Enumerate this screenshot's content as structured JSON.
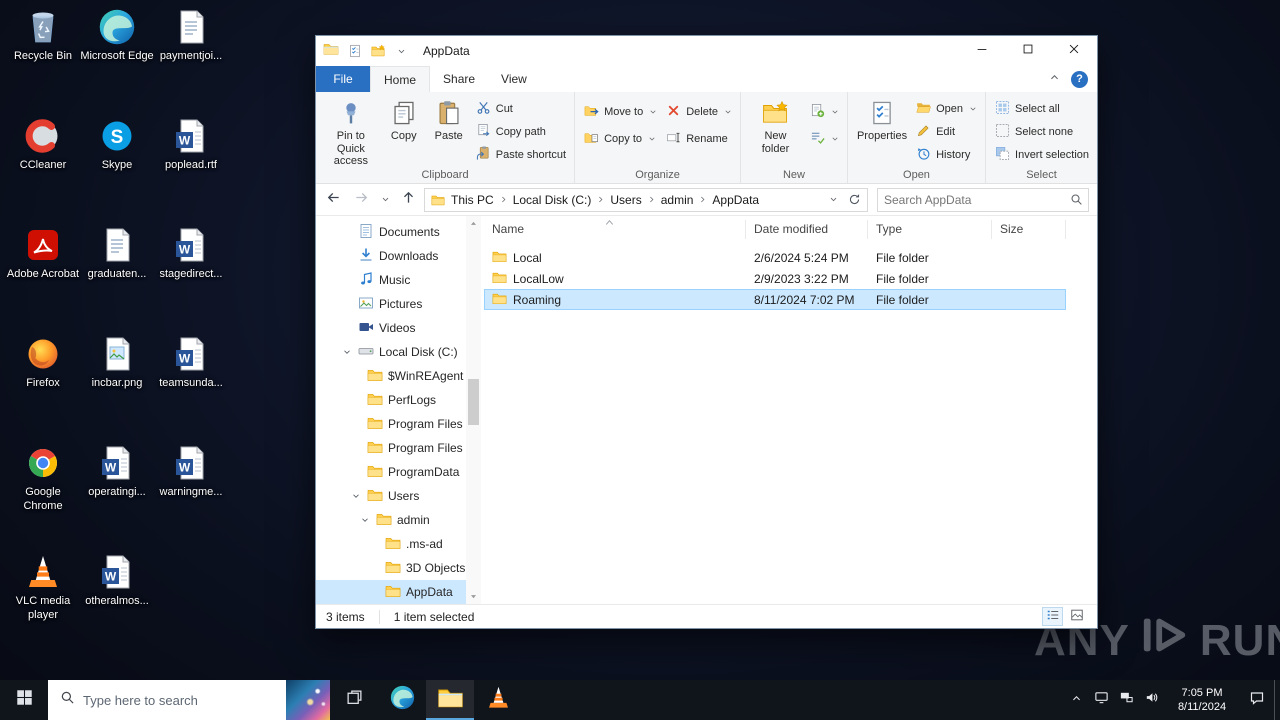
{
  "colors": {
    "accent": "#2a70c2",
    "selection": "#cce8ff",
    "selection_border": "#99d1ff",
    "folder_yellow": "#ffd262",
    "taskbar_bg": "#10141b",
    "desktop_bg": "#0b101f",
    "desktop_glow": "#17203a"
  },
  "desktop": {
    "icons": [
      {
        "label": "Recycle Bin",
        "icon": "recycle-bin"
      },
      {
        "label": "CCleaner",
        "icon": "ccleaner"
      },
      {
        "label": "Adobe Acrobat",
        "icon": "acrobat"
      },
      {
        "label": "Firefox",
        "icon": "firefox"
      },
      {
        "label": "Google Chrome",
        "icon": "chrome"
      },
      {
        "label": "VLC media player",
        "icon": "vlc"
      },
      {
        "label": "Microsoft Edge",
        "icon": "edge"
      },
      {
        "label": "Skype",
        "icon": "skype"
      },
      {
        "label": "graduaten...",
        "icon": "text-doc"
      },
      {
        "label": "incbar.png",
        "icon": "image-file"
      },
      {
        "label": "operatingi...",
        "icon": "word-doc"
      },
      {
        "label": "otheralmos...",
        "icon": "word-doc"
      },
      {
        "label": "paymentjoi...",
        "icon": "text-doc"
      },
      {
        "label": "poplead.rtf",
        "icon": "word-doc"
      },
      {
        "label": "stagedirect...",
        "icon": "word-doc"
      },
      {
        "label": "teamsunda...",
        "icon": "word-doc"
      },
      {
        "label": "warningme...",
        "icon": "word-doc"
      }
    ],
    "watermark": {
      "left": "ANY",
      "right": "RUN"
    }
  },
  "explorer": {
    "titlebar": {
      "title": "AppData"
    },
    "menubar": {
      "file": "File",
      "tabs": [
        "Home",
        "Share",
        "View"
      ],
      "help": "?"
    },
    "ribbon": {
      "group_labels": [
        "Clipboard",
        "Organize",
        "New",
        "Open",
        "Select"
      ],
      "clipboard": {
        "pin": "Pin to Quick access",
        "copy": "Copy",
        "paste": "Paste",
        "cut": "Cut",
        "copy_path": "Copy path",
        "paste_shortcut": "Paste shortcut"
      },
      "organize": {
        "move_to": "Move to",
        "copy_to": "Copy to",
        "delete": "Delete",
        "rename": "Rename"
      },
      "new_group": {
        "new_folder": "New folder"
      },
      "open_group": {
        "properties": "Properties",
        "open": "Open",
        "edit": "Edit",
        "history": "History"
      },
      "select": {
        "select_all": "Select all",
        "select_none": "Select none",
        "invert": "Invert selection"
      }
    },
    "addressbar": {
      "breadcrumb": [
        "This PC",
        "Local Disk (C:)",
        "Users",
        "admin",
        "AppData"
      ],
      "search_placeholder": "Search AppData"
    },
    "nav": [
      {
        "label": "Documents",
        "icon": "documents",
        "indent": 0
      },
      {
        "label": "Downloads",
        "icon": "downloads",
        "indent": 0
      },
      {
        "label": "Music",
        "icon": "music",
        "indent": 0
      },
      {
        "label": "Pictures",
        "icon": "pictures",
        "indent": 0
      },
      {
        "label": "Videos",
        "icon": "videos",
        "indent": 0
      },
      {
        "label": "Local Disk (C:)",
        "icon": "drive",
        "indent": 0,
        "expanded": true
      },
      {
        "label": "$WinREAgent",
        "icon": "folder",
        "indent": 1
      },
      {
        "label": "PerfLogs",
        "icon": "folder",
        "indent": 1
      },
      {
        "label": "Program Files",
        "icon": "folder",
        "indent": 1
      },
      {
        "label": "Program Files",
        "icon": "folder",
        "indent": 1
      },
      {
        "label": "ProgramData",
        "icon": "folder",
        "indent": 1
      },
      {
        "label": "Users",
        "icon": "folder",
        "indent": 1,
        "expanded": true
      },
      {
        "label": "admin",
        "icon": "folder",
        "indent": 2,
        "expanded": true
      },
      {
        "label": ".ms-ad",
        "icon": "folder",
        "indent": 3
      },
      {
        "label": "3D Objects",
        "icon": "folder",
        "indent": 3
      },
      {
        "label": "AppData",
        "icon": "folder",
        "indent": 3,
        "selected": true
      }
    ],
    "files": {
      "columns": [
        "Name",
        "Date modified",
        "Type",
        "Size"
      ],
      "rows": [
        {
          "name": "Local",
          "date": "2/6/2024 5:24 PM",
          "type": "File folder",
          "size": ""
        },
        {
          "name": "LocalLow",
          "date": "2/9/2023 3:22 PM",
          "type": "File folder",
          "size": ""
        },
        {
          "name": "Roaming",
          "date": "8/11/2024 7:02 PM",
          "type": "File fol­der",
          "size": "",
          "selected": true
        }
      ]
    },
    "statusbar": {
      "count": "3 items",
      "selected": "1 item selected"
    }
  },
  "taskbar": {
    "search_placeholder": "Type here to search",
    "clock": {
      "time": "7:05 PM",
      "date": "8/11/2024"
    }
  }
}
